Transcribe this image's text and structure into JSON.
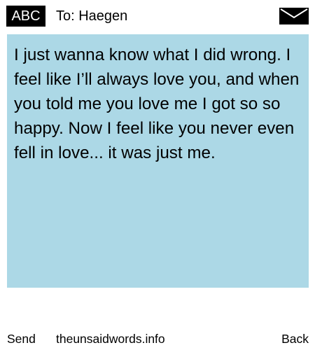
{
  "header": {
    "mode_label": "ABC",
    "recipient_text": "To: Haegen",
    "mail_icon": "envelope-icon"
  },
  "message": {
    "background_color": "#acd8e6",
    "body": "I just wanna know what I did wrong. I feel like I’ll always love you, and when you told me you love me I got so so happy. Now I feel like you never even fell in love... it was just me."
  },
  "footer": {
    "send_label": "Send",
    "site_label": "theunsaidwords.info",
    "back_label": "Back"
  }
}
